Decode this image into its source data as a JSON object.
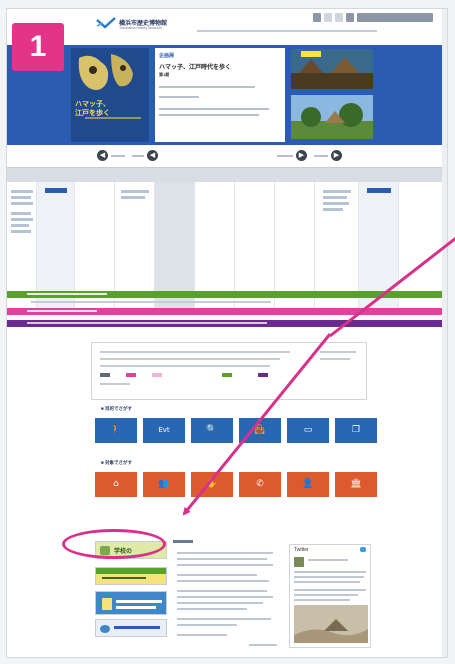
{
  "step_number": "1",
  "header": {
    "site_name": "横浜市歴史博物館",
    "site_sub": "Yokohama History Museum",
    "top_nav": [
      "",
      "",
      "",
      "",
      ""
    ],
    "sub_nav": [
      "",
      "",
      "",
      ""
    ]
  },
  "banner": {
    "exhibit_tag": "企画展",
    "exhibit_title": "ハマッ子、江戸時代を歩く",
    "exhibit_sub": "第1期",
    "poster_title_1": "ハマッ子、",
    "poster_title_2": "江戸を歩く"
  },
  "date_nav": {
    "left_arrow": "◀",
    "right_arrow": "▶"
  },
  "sections": {
    "first_head": "■ 目的でさがす",
    "second_head": "■ 対象でさがす"
  },
  "tiles_row1": [
    {
      "icon": "walk-icon",
      "glyph": "🚶",
      "label": ""
    },
    {
      "icon": "event-icon",
      "glyph": "Evt",
      "label": ""
    },
    {
      "icon": "search-icon",
      "glyph": "🔍",
      "label": ""
    },
    {
      "icon": "bag-icon",
      "glyph": "👜",
      "label": ""
    },
    {
      "icon": "screen-icon",
      "glyph": "▭",
      "label": ""
    },
    {
      "icon": "document-icon",
      "glyph": "❐",
      "label": ""
    }
  ],
  "tiles_row2": [
    {
      "icon": "school-icon",
      "glyph": "⌂",
      "label": ""
    },
    {
      "icon": "group-icon",
      "glyph": "👥",
      "label": ""
    },
    {
      "icon": "handshake-icon",
      "glyph": "✋",
      "label": ""
    },
    {
      "icon": "phone-icon",
      "glyph": "✆",
      "label": ""
    },
    {
      "icon": "person-icon",
      "glyph": "👤",
      "label": ""
    },
    {
      "icon": "building-icon",
      "glyph": "🏛",
      "label": ""
    }
  ],
  "side_banners": {
    "first": "学校の",
    "second": "",
    "third": "",
    "fourth": ""
  },
  "widget_title": "Twitter",
  "colors": {
    "accent": "#e4348a",
    "banner": "#2a5db2",
    "tile_blue": "#2867b4",
    "tile_red": "#dd5a2e",
    "bar_green": "#5aa02c",
    "bar_pink": "#e0429a",
    "bar_purple": "#6a2a8e"
  }
}
